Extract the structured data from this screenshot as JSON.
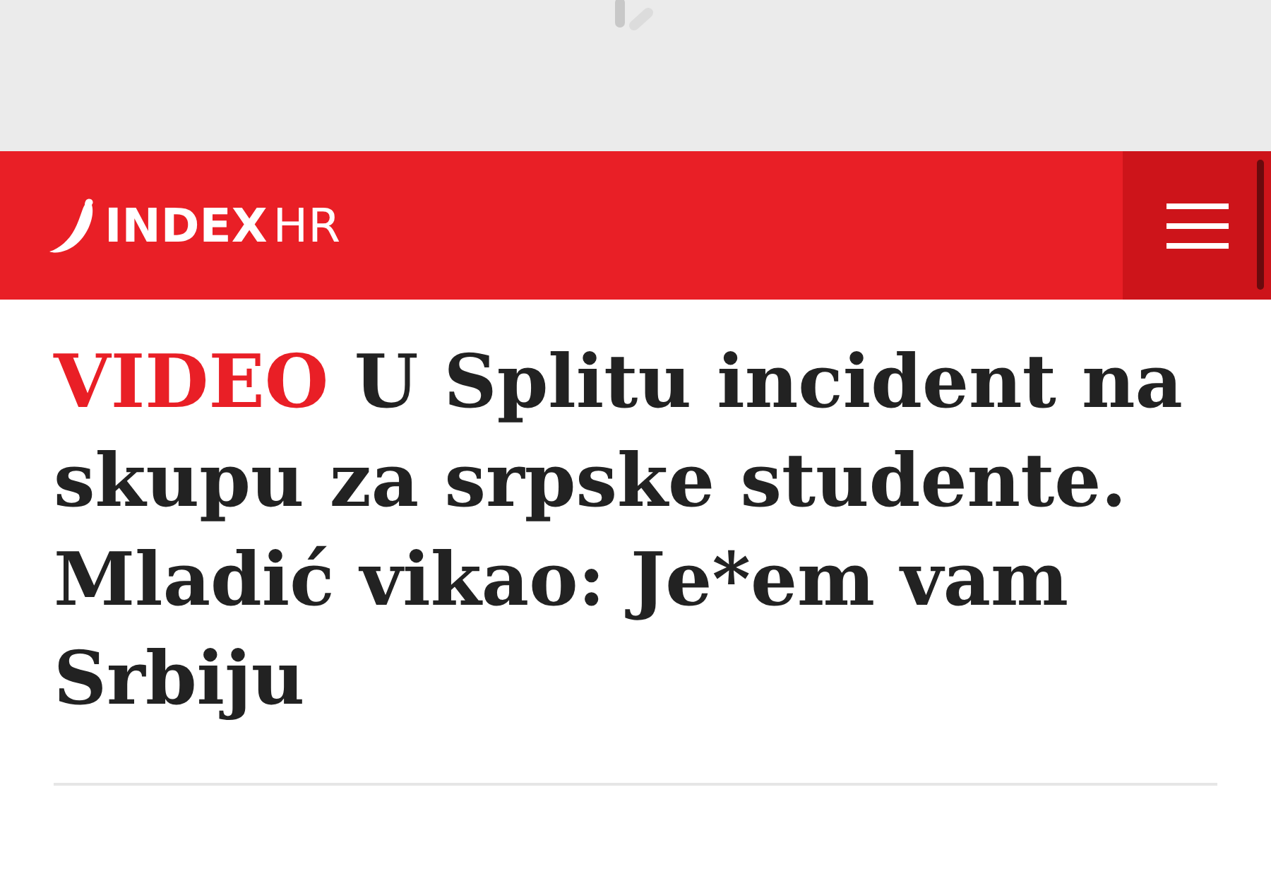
{
  "header": {
    "logo": {
      "main": "INDEX",
      "suffix": "HR"
    }
  },
  "article": {
    "label": "VIDEO",
    "title": "U Splitu incident na skupu za srpske studente. Mladić vikao: Je*em vam Srbiju"
  }
}
